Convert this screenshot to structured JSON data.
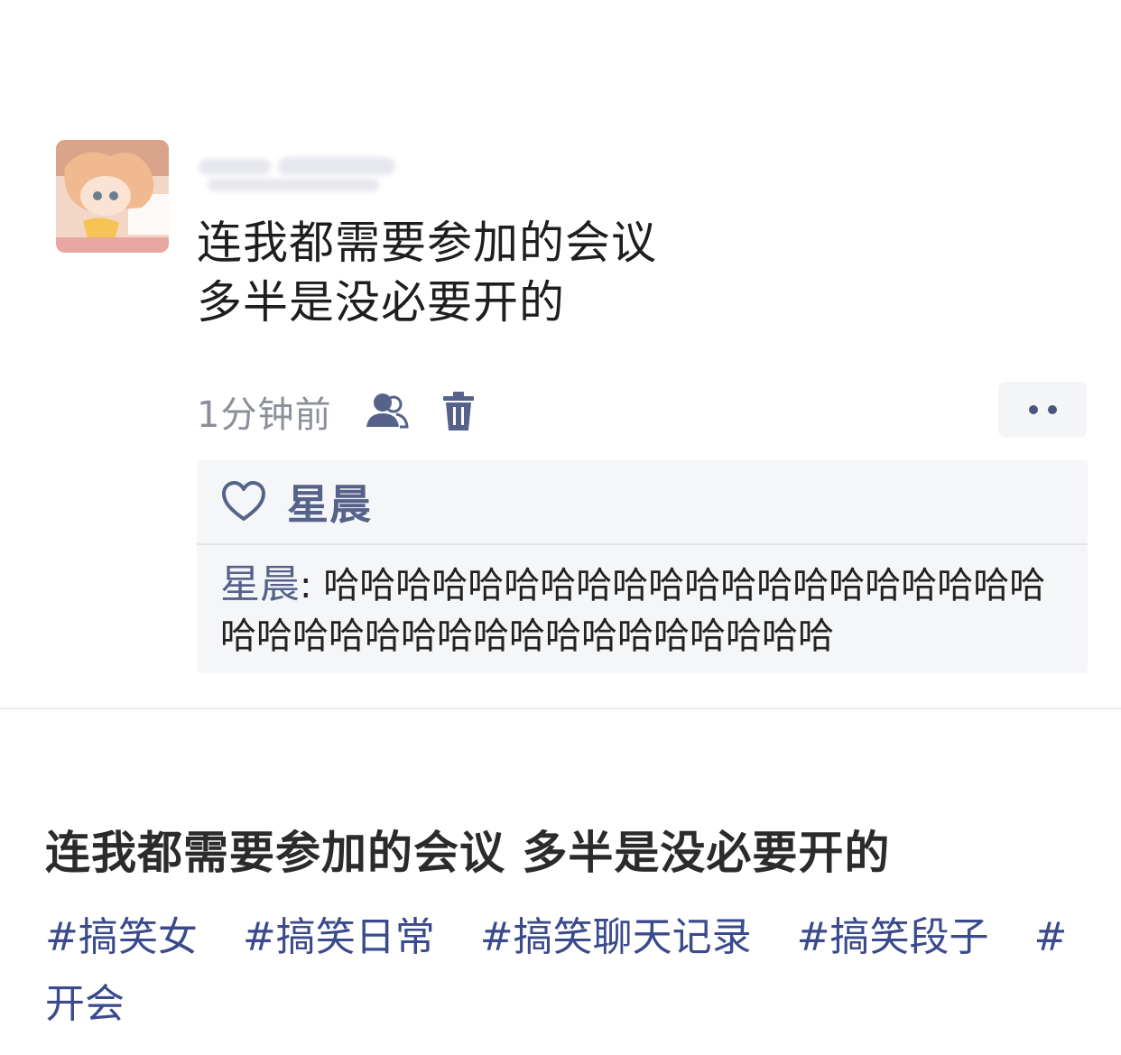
{
  "post": {
    "avatar_icon": "anime-girl-avatar",
    "username_blurred": true,
    "text_lines": [
      "连我都需要参加的会议",
      "多半是没必要开的"
    ],
    "timestamp": "1分钟前",
    "icons": {
      "audience": "people-icon",
      "delete": "trash-icon",
      "more": "more-dots-icon"
    },
    "likes": {
      "icon": "heart-icon",
      "names": "星晨"
    },
    "comments": [
      {
        "author": "星晨",
        "separator": ": ",
        "text": "哈哈哈哈哈哈哈哈哈哈哈哈哈哈哈哈哈哈哈哈哈哈哈哈哈哈哈哈哈哈哈哈哈哈哈哈哈"
      }
    ]
  },
  "caption": {
    "title": "连我都需要参加的会议 多半是没必要开的",
    "tags": [
      "#搞笑女",
      "#搞笑日常",
      "#搞笑聊天记录",
      "#搞笑段子",
      "#开会"
    ]
  },
  "colors": {
    "link_blue": "#56628a",
    "tag_blue": "#3a4a8c",
    "box_bg": "#f5f6f8"
  }
}
